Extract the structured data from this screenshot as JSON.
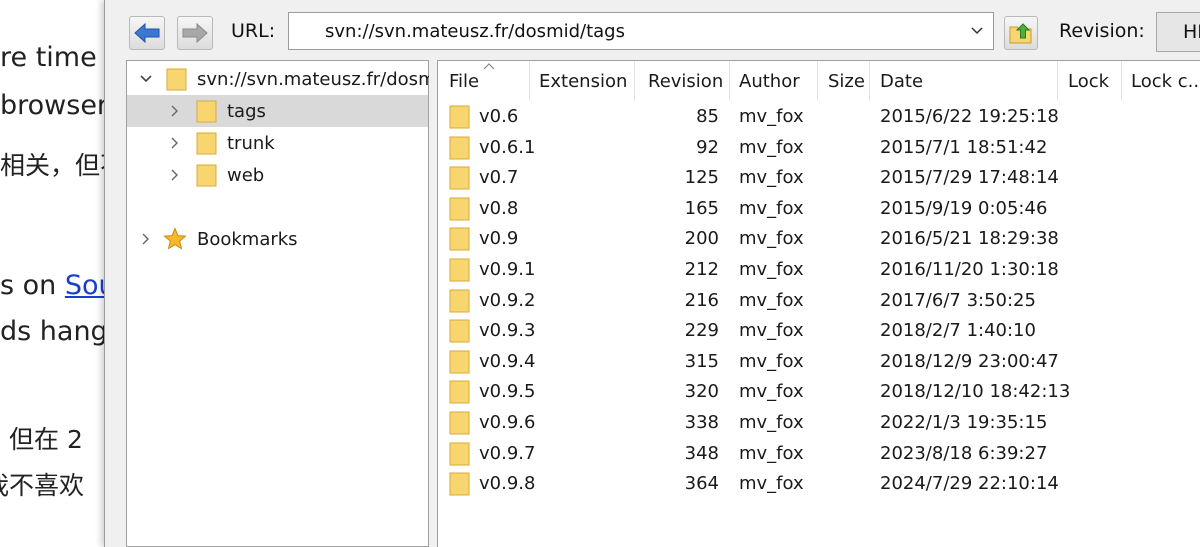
{
  "background_page": {
    "lines": [
      {
        "text": "re time"
      },
      {
        "text": "browser"
      },
      {
        "text": "相关，但不"
      },
      {
        "text_before": "s on ",
        "link": "Sou"
      },
      {
        "text": "ds hang"
      },
      {
        "text": "。但在 2"
      },
      {
        "text": "我不喜欢"
      }
    ]
  },
  "toolbar": {
    "url_label": "URL:",
    "url_value": "svn://svn.mateusz.fr/dosmid/tags",
    "revision_label": "Revision:",
    "revision_value": "HEAD"
  },
  "tree": {
    "root": {
      "label": "svn://svn.mateusz.fr/dosmid"
    },
    "children": [
      {
        "label": "tags",
        "selected": true
      },
      {
        "label": "trunk",
        "selected": false
      },
      {
        "label": "web",
        "selected": false
      }
    ],
    "bookmarks": {
      "label": "Bookmarks"
    }
  },
  "file_list": {
    "columns": [
      "File",
      "Extension",
      "Revision",
      "Author",
      "Size",
      "Date",
      "Lock",
      "Lock c..."
    ],
    "rows": [
      {
        "file": "v0.6",
        "revision": "85",
        "author": "mv_fox",
        "date": "2015/6/22 19:25:18"
      },
      {
        "file": "v0.6.1",
        "revision": "92",
        "author": "mv_fox",
        "date": "2015/7/1 18:51:42"
      },
      {
        "file": "v0.7",
        "revision": "125",
        "author": "mv_fox",
        "date": "2015/7/29 17:48:14"
      },
      {
        "file": "v0.8",
        "revision": "165",
        "author": "mv_fox",
        "date": "2015/9/19 0:05:46"
      },
      {
        "file": "v0.9",
        "revision": "200",
        "author": "mv_fox",
        "date": "2016/5/21 18:29:38"
      },
      {
        "file": "v0.9.1",
        "revision": "212",
        "author": "mv_fox",
        "date": "2016/11/20 1:30:18"
      },
      {
        "file": "v0.9.2",
        "revision": "216",
        "author": "mv_fox",
        "date": "2017/6/7 3:50:25"
      },
      {
        "file": "v0.9.3",
        "revision": "229",
        "author": "mv_fox",
        "date": "2018/2/7 1:40:10"
      },
      {
        "file": "v0.9.4",
        "revision": "315",
        "author": "mv_fox",
        "date": "2018/12/9 23:00:47"
      },
      {
        "file": "v0.9.5",
        "revision": "320",
        "author": "mv_fox",
        "date": "2018/12/10 18:42:13"
      },
      {
        "file": "v0.9.6",
        "revision": "338",
        "author": "mv_fox",
        "date": "2022/1/3 19:35:15"
      },
      {
        "file": "v0.9.7",
        "revision": "348",
        "author": "mv_fox",
        "date": "2023/8/18 6:39:27"
      },
      {
        "file": "v0.9.8",
        "revision": "364",
        "author": "mv_fox",
        "date": "2024/7/29 22:10:14"
      }
    ]
  },
  "icons": {
    "back": "arrow-left-icon",
    "forward": "arrow-right-icon",
    "go": "folder-up-icon",
    "folder": "folder-icon",
    "bookmarks": "star-icon"
  },
  "colors": {
    "folder": "#f7d66f",
    "folder_edge": "#d9a93a",
    "selection": "#d9d9d9",
    "link": "#1a3ecb",
    "back_arrow": "#3a78d1"
  }
}
